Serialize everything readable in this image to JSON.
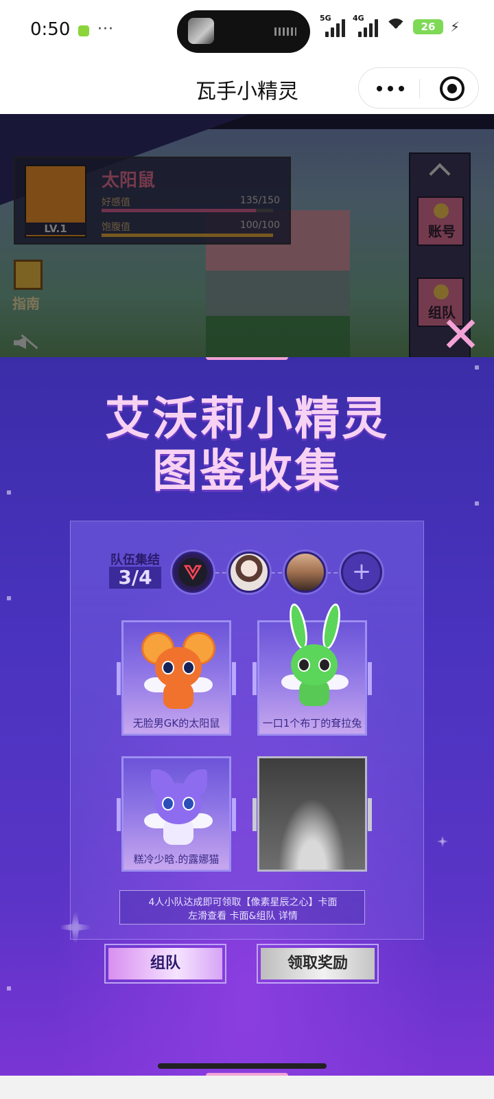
{
  "status_bar": {
    "time": "0:50",
    "more": "···",
    "signal_1": "5G",
    "signal_2": "4G",
    "wifi_level": "6",
    "battery": "26"
  },
  "nav": {
    "title": "瓦手小精灵"
  },
  "game": {
    "pet_name": "太阳鼠",
    "level": "LV.1",
    "favor_label": "好感值",
    "favor_value": "135/150",
    "favor_fraction": 0.9,
    "satiety_label": "饱腹值",
    "satiety_value": "100/100",
    "satiety_fraction": 1.0,
    "guide_label": "指南",
    "account_label": "账号",
    "team_label": "组队"
  },
  "popup": {
    "title_line1": "艾沃莉小精灵",
    "title_line2": "图鉴收集",
    "team_label": "队伍集结",
    "team_count": "3/4",
    "add_member": "+",
    "slots": [
      {
        "name": "无脸男GK的太阳鼠",
        "state": "collected"
      },
      {
        "name": "一口1个布丁的耷拉兔",
        "state": "collected"
      },
      {
        "name": "糕冷少晗.的露娜猫",
        "state": "collected"
      },
      {
        "name": "",
        "state": "empty"
      }
    ],
    "tip_line1": "4人小队达成即可领取【像素星辰之心】卡面",
    "tip_line2": "左滑查看 卡面&组队 详情",
    "btn_team": "组队",
    "btn_claim": "领取奖励"
  },
  "colors": {
    "accent_pink": "#f3a2d6",
    "popup_purple": "#4a33bf"
  }
}
